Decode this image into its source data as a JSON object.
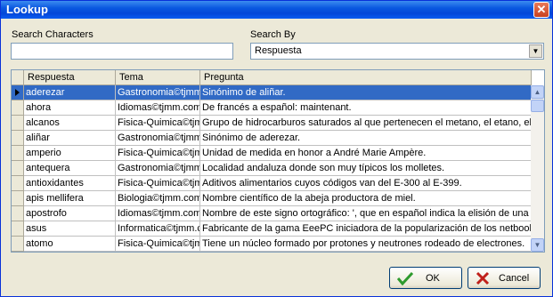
{
  "window": {
    "title": "Lookup"
  },
  "search": {
    "label": "Search Characters",
    "value": ""
  },
  "search_by": {
    "label": "Search By",
    "selected": "Respuesta"
  },
  "grid": {
    "columns": [
      "Respuesta",
      "Tema",
      "Pregunta"
    ],
    "rows": [
      [
        "aderezar",
        "Gastronomia©tjmm.",
        "Sinónimo de aliñar."
      ],
      [
        "ahora",
        "Idiomas©tjmm.com",
        "De francés a español: maintenant."
      ],
      [
        "alcanos",
        "Fisica-Quimica©tjm",
        "Grupo de hidrocarburos saturados al que pertenecen el metano, el etano, el pr"
      ],
      [
        "aliñar",
        "Gastronomia©tjmm.",
        "Sinónimo de aderezar."
      ],
      [
        "amperio",
        "Fisica-Quimica©tjm",
        "Unidad de medida en honor a André Marie Ampère."
      ],
      [
        "antequera",
        "Gastronomia©tjmm.",
        "Localidad andaluza donde son muy típicos los molletes."
      ],
      [
        "antioxidantes",
        "Fisica-Quimica©tjm",
        "Aditivos alimentarios cuyos códigos van del E-300 al E-399."
      ],
      [
        "apis mellifera",
        "Biologia©tjmm.com",
        "Nombre científico de la abeja productora de miel."
      ],
      [
        "apostrofo",
        "Idiomas©tjmm.com",
        "Nombre de este signo ortográfico: ', que en español indica la elisión de una let"
      ],
      [
        "asus",
        "Informatica©tjmm.c",
        "Fabricante de la gama EeePC iniciadora de la popularización de los netbooks."
      ],
      [
        "atomo",
        "Fisica-Quimica©tjm",
        "Tiene un núcleo formado por protones y neutrones rodeado de electrones."
      ]
    ],
    "selected_index": 0
  },
  "buttons": {
    "ok": "OK",
    "cancel": "Cancel"
  },
  "icons": {
    "close": "close-icon",
    "ok": "checkmark-icon",
    "cancel": "x-icon"
  }
}
